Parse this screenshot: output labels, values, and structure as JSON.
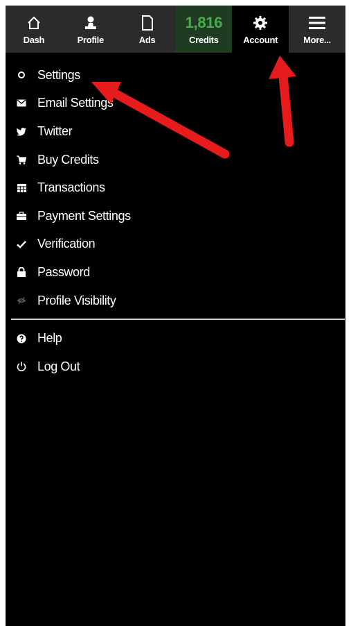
{
  "navbar": {
    "items": [
      {
        "label": "Dash",
        "icon": "home-icon"
      },
      {
        "label": "Profile",
        "icon": "user-icon"
      },
      {
        "label": "Ads",
        "icon": "document-icon"
      },
      {
        "label": "Credits",
        "value": "1,816"
      },
      {
        "label": "Account",
        "icon": "gear-icon"
      },
      {
        "label": "More...",
        "icon": "hamburger-icon"
      }
    ]
  },
  "menu": {
    "items": [
      {
        "label": "Settings",
        "icon": "circle-icon"
      },
      {
        "label": "Email Settings",
        "icon": "envelope-icon"
      },
      {
        "label": "Twitter",
        "icon": "twitter-bird-icon"
      },
      {
        "label": "Buy Credits",
        "icon": "cart-icon"
      },
      {
        "label": "Transactions",
        "icon": "table-icon"
      },
      {
        "label": "Payment Settings",
        "icon": "briefcase-icon"
      },
      {
        "label": "Verification",
        "icon": "checkmark-icon"
      },
      {
        "label": "Password",
        "icon": "lock-icon"
      },
      {
        "label": "Profile Visibility",
        "icon": "eye-slash-icon"
      }
    ],
    "footer_items": [
      {
        "label": "Help",
        "icon": "question-circle-icon"
      },
      {
        "label": "Log Out",
        "icon": "power-icon"
      }
    ]
  },
  "colors": {
    "navbar_bg": "#2b2b2b",
    "credits_value": "#43b04a",
    "annotation_arrow": "#e61b1b"
  }
}
